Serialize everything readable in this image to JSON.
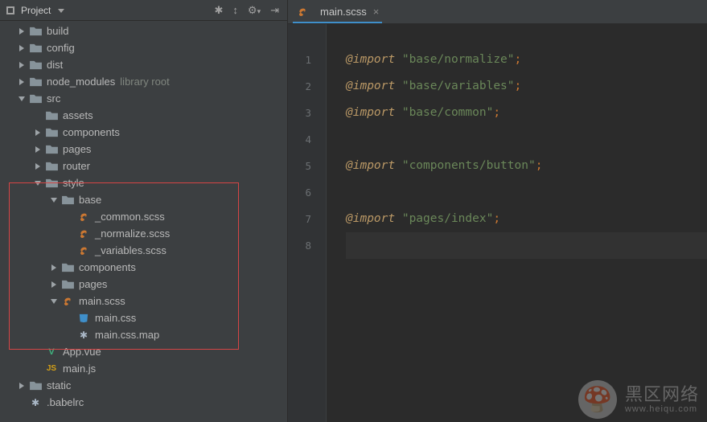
{
  "panel": {
    "title": "Project"
  },
  "tree": [
    {
      "indent": 0,
      "arrow": "right",
      "icon": "folder",
      "label": "build"
    },
    {
      "indent": 0,
      "arrow": "right",
      "icon": "folder",
      "label": "config"
    },
    {
      "indent": 0,
      "arrow": "right",
      "icon": "folder",
      "label": "dist"
    },
    {
      "indent": 0,
      "arrow": "right",
      "icon": "folder",
      "label": "node_modules",
      "comment": "library root"
    },
    {
      "indent": 0,
      "arrow": "down",
      "icon": "folder",
      "label": "src"
    },
    {
      "indent": 1,
      "arrow": "none",
      "icon": "folder",
      "label": "assets"
    },
    {
      "indent": 1,
      "arrow": "right",
      "icon": "folder",
      "label": "components"
    },
    {
      "indent": 1,
      "arrow": "right",
      "icon": "folder",
      "label": "pages"
    },
    {
      "indent": 1,
      "arrow": "right",
      "icon": "folder",
      "label": "router"
    },
    {
      "indent": 1,
      "arrow": "down",
      "icon": "folder",
      "label": "style"
    },
    {
      "indent": 2,
      "arrow": "down",
      "icon": "folder",
      "label": "base"
    },
    {
      "indent": 3,
      "arrow": "none",
      "icon": "sass",
      "label": "_common.scss"
    },
    {
      "indent": 3,
      "arrow": "none",
      "icon": "sass",
      "label": "_normalize.scss"
    },
    {
      "indent": 3,
      "arrow": "none",
      "icon": "sass",
      "label": "_variables.scss"
    },
    {
      "indent": 2,
      "arrow": "right",
      "icon": "folder",
      "label": "components"
    },
    {
      "indent": 2,
      "arrow": "right",
      "icon": "folder",
      "label": "pages"
    },
    {
      "indent": 2,
      "arrow": "down",
      "icon": "sass",
      "label": "main.scss"
    },
    {
      "indent": 3,
      "arrow": "none",
      "icon": "css",
      "label": "main.css"
    },
    {
      "indent": 3,
      "arrow": "none",
      "icon": "map",
      "label": "main.css.map"
    },
    {
      "indent": 1,
      "arrow": "none",
      "icon": "vue",
      "label": "App.vue"
    },
    {
      "indent": 1,
      "arrow": "none",
      "icon": "js",
      "label": "main.js"
    },
    {
      "indent": 0,
      "arrow": "right",
      "icon": "folder",
      "label": "static"
    },
    {
      "indent": 0,
      "arrow": "none",
      "icon": "dot",
      "label": ".babelrc"
    }
  ],
  "tab": {
    "title": "main.scss"
  },
  "code": {
    "lines": [
      {
        "n": 1,
        "kw": "@import",
        "str": "\"base/normalize\"",
        "semi": true
      },
      {
        "n": 2,
        "kw": "@import",
        "str": "\"base/variables\"",
        "semi": true
      },
      {
        "n": 3,
        "kw": "@import",
        "str": "\"base/common\"",
        "semi": true
      },
      {
        "n": 4,
        "blank": true
      },
      {
        "n": 5,
        "kw": "@import",
        "str": "\"components/button\"",
        "semi": true
      },
      {
        "n": 6,
        "blank": true
      },
      {
        "n": 7,
        "kw": "@import",
        "str": "\"pages/index\"",
        "semi": true
      },
      {
        "n": 8,
        "blank": true,
        "cursor": true
      }
    ]
  },
  "watermark": {
    "main": "黑区网络",
    "sub": "www.heiqu.com"
  }
}
